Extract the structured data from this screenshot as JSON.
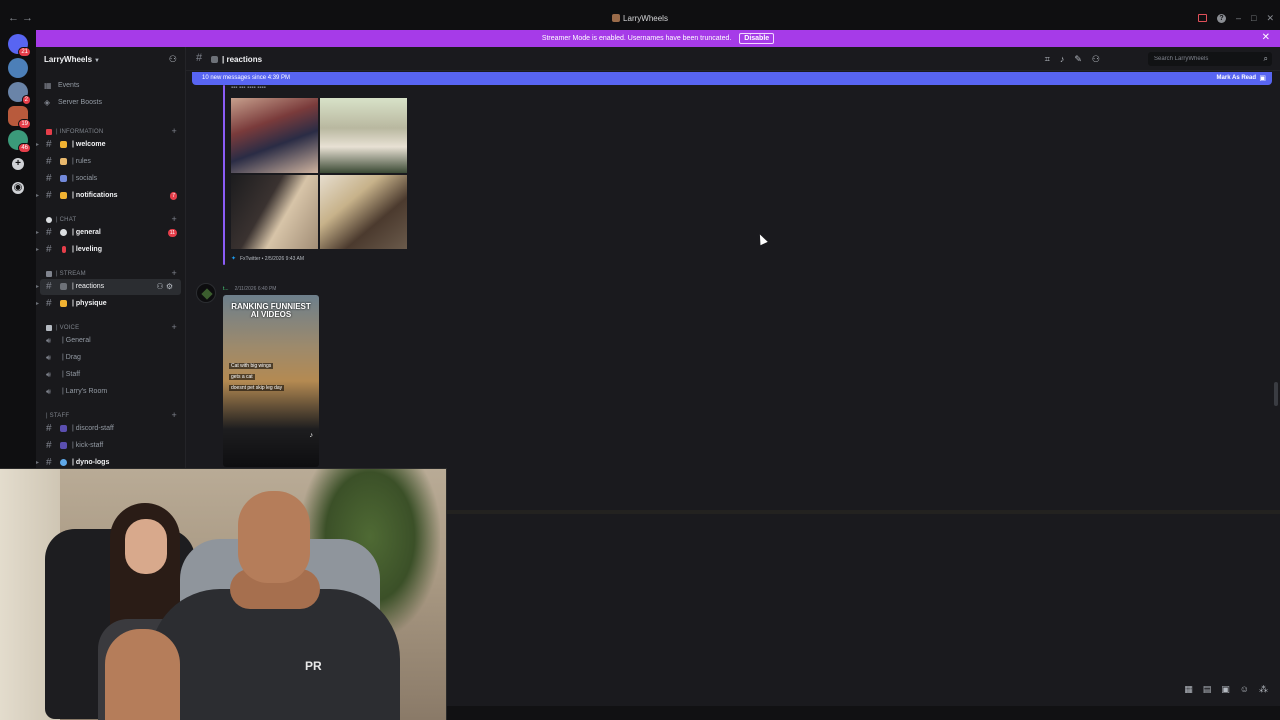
{
  "window": {
    "title": "LarryWheels",
    "nav_back": "←",
    "nav_forward": "→",
    "minimize": "–",
    "maximize": "□",
    "close": "✕"
  },
  "banner": {
    "text": "Streamer Mode is enabled. Usernames have been truncated.",
    "disable_label": "Disable",
    "close": "✕"
  },
  "rail": {
    "servers": [
      {
        "badge": "21",
        "color": "#5865f2"
      },
      {
        "badge": "",
        "color": "#4c7fb8"
      },
      {
        "badge": "2",
        "color": "#6a84a8"
      },
      {
        "badge": "19",
        "color": "#b85a3c"
      },
      {
        "badge": "46",
        "color": "#3b9a7a"
      }
    ],
    "add_server": "+",
    "discover": "◉"
  },
  "sidebar": {
    "guild_name": "LarryWheels",
    "top_items": [
      {
        "icon": "▦",
        "label": "Events"
      },
      {
        "icon": "◈",
        "label": "Server Boosts"
      }
    ],
    "categories": {
      "information": "| INFORMATION",
      "chat": "| CHAT",
      "stream": "| STREAM",
      "voice": "| VOICE",
      "staff": "| STAFF"
    },
    "channels": {
      "welcome": "| welcome",
      "rules": "| rules",
      "socials": "| socials",
      "notifications": "| notifications",
      "notifications_badge": "7",
      "general": "| general",
      "general_badge": "11",
      "leveling": "| leveling",
      "reactions": "| reactions",
      "physique": "| physique",
      "vc_general": "| General",
      "vc_drag": "| Drag",
      "vc_staff": "| Staff",
      "vc_larry": "| Larry's Room",
      "discord_staff": "| discord-staff",
      "kick_staff": "| kick-staff",
      "dyno_logs": "| dyno-logs"
    }
  },
  "header": {
    "channel_name": "| reactions",
    "search_placeholder": "Search LarryWheels"
  },
  "new_messages": {
    "text": "10 new messages since 4:39 PM",
    "mark_read": "Mark As Read"
  },
  "messages": {
    "embed_footer": "FxTwitter • 2/5/2026 9:43 AM",
    "second_user": "t...",
    "second_timestamp": "2/11/2026 6:40 PM",
    "video_title_1": "RANKING FUNNIEST",
    "video_title_2": "AI VIDEOS",
    "video_caption_1": "Cat with big wings",
    "video_caption_2": "gets a cat",
    "video_caption_3": "doesnt pet skip leg day"
  },
  "webcam": {
    "shirt_logo": "PR"
  },
  "colors": {
    "banner": "#a63be8",
    "new_messages_bar": "#5865f2",
    "badge_red": "#e53e4a",
    "background": "#1a1a1e"
  }
}
